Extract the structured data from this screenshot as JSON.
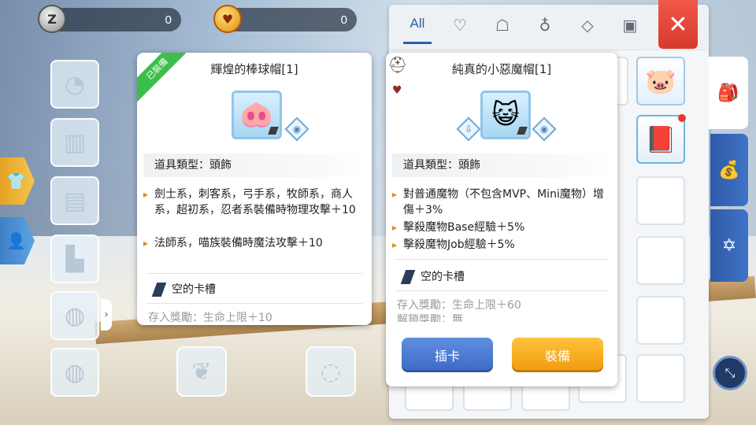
{
  "currency": {
    "zeny": {
      "icon": "zeny-coin-icon",
      "value": "0"
    },
    "heart": {
      "icon": "heart-coin-icon",
      "value": "0"
    }
  },
  "inventory": {
    "tabs": [
      {
        "label": "All",
        "icon": "all-tab",
        "active": true
      },
      {
        "label": "",
        "icon": "heart-icon"
      },
      {
        "label": "",
        "icon": "shirt-icon"
      },
      {
        "label": "",
        "icon": "potion-icon"
      },
      {
        "label": "",
        "icon": "diamond-icon"
      },
      {
        "label": "",
        "icon": "card-icon"
      }
    ]
  },
  "equipped_item": {
    "badge": "已裝備",
    "title": "輝煌的棒球帽[1]",
    "type_label": "道具類型：頭飾",
    "effects": [
      "劍士系，刺客系，弓手系，牧師系，商人系，超初系，忍者系裝備時物理攻擊＋10",
      "法師系，喵族裝備時魔法攻擊＋10"
    ],
    "card_slot": "空的卡槽",
    "deposit": "存入獎勵：生命上限＋10"
  },
  "selected_item": {
    "title": "純真的小惡魔帽[1]",
    "type_label": "道具類型：頭飾",
    "effects": [
      "對普通魔物（不包含MVP、Mini魔物）增傷＋3%",
      "擊殺魔物Base經驗＋5%",
      "擊殺魔物Job經驗＋5%"
    ],
    "card_slot": "空的卡槽",
    "deposit": "存入獎勵：生命上限＋60",
    "deposit2": "解鎖獎勵：無",
    "btn_insert": "插卡",
    "btn_equip": "裝備"
  },
  "close_label": "✕",
  "colors": {
    "accent_blue": "#2d5fa8",
    "equip_orange": "#f09a0c",
    "close_red": "#d63a2c",
    "equipped_green": "#3bbf4a"
  }
}
